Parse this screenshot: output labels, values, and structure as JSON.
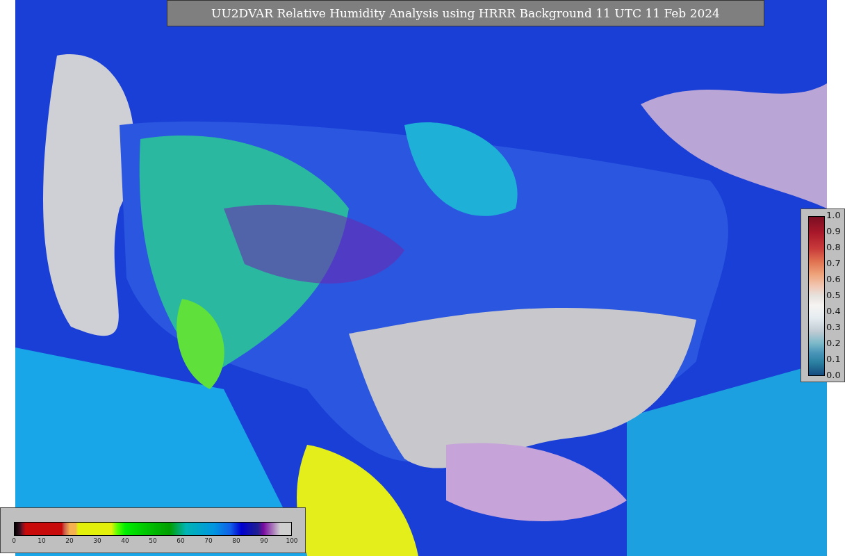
{
  "title": "UU2DVAR Relative Humidity Analysis using HRRR Background 11 UTC 11 Feb 2024",
  "humidity_legend": {
    "ticks": [
      "0",
      "10",
      "20",
      "30",
      "40",
      "50",
      "60",
      "70",
      "80",
      "90",
      "100"
    ]
  },
  "observation_legend": {
    "ticks": [
      "1.0",
      "0.9",
      "0.8",
      "0.7",
      "0.6",
      "0.5",
      "0.4",
      "0.3",
      "0.2",
      "0.1",
      "0.0"
    ]
  }
}
